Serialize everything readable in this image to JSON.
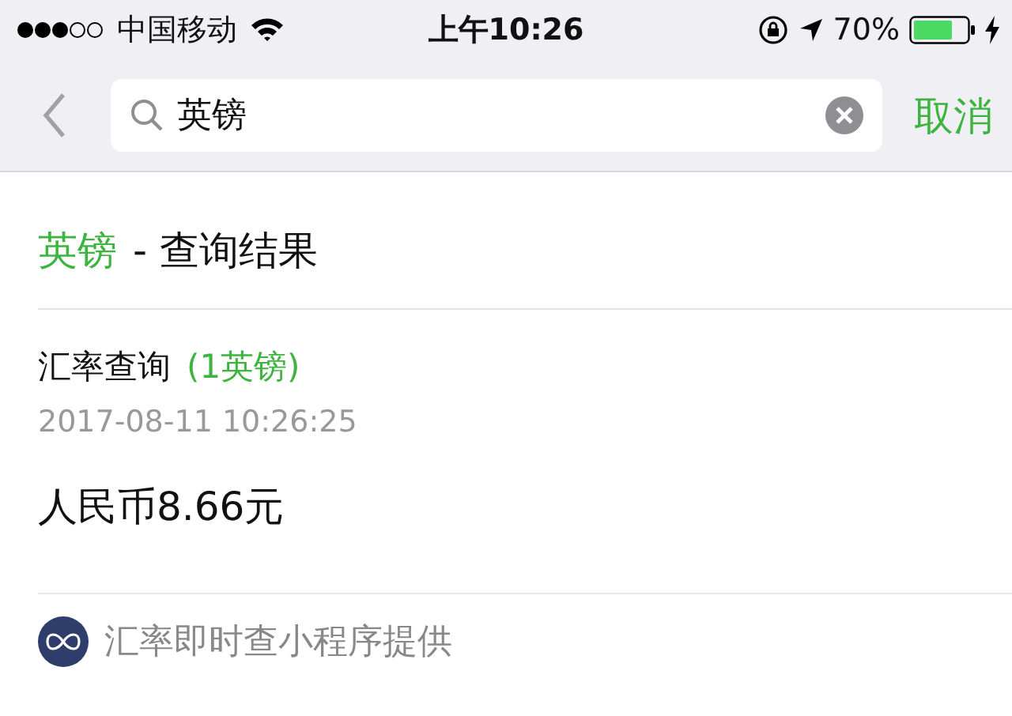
{
  "status_bar": {
    "carrier": "中国移动",
    "time": "上午10:26",
    "battery": "70%"
  },
  "search": {
    "value": "英镑",
    "cancel": "取消"
  },
  "result_header": {
    "keyword": "英镑",
    "suffix": "- 查询结果"
  },
  "result": {
    "title": "汇率查询",
    "tag": "(1英镑)",
    "timestamp": "2017-08-11 10:26:25",
    "value": "人民币8.66元"
  },
  "footer": {
    "text": "汇率即时查小程序提供"
  }
}
